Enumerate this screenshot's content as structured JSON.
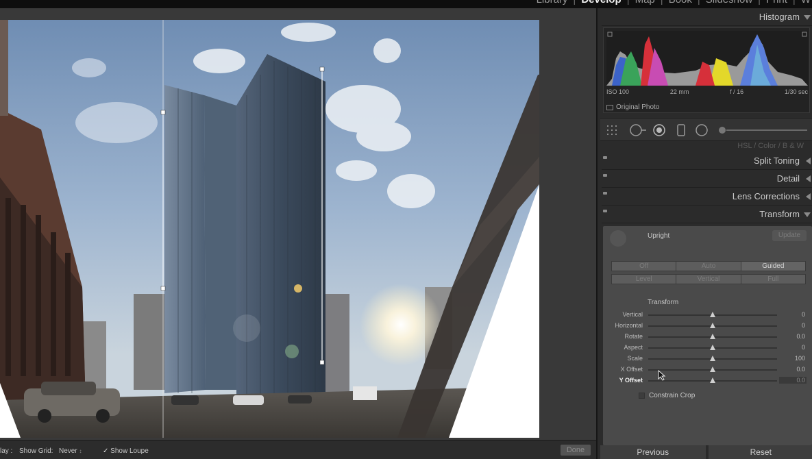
{
  "modules": [
    "Library",
    "Develop",
    "Map",
    "Book",
    "Slideshow",
    "Print",
    "W"
  ],
  "active_module": "Develop",
  "histogram": {
    "title": "Histogram",
    "iso": "ISO 100",
    "focal": "22 mm",
    "aperture": "f / 16",
    "shutter": "1/30 sec",
    "original_photo": "Original Photo"
  },
  "hsl_tabs": "HSL / Color / B & W",
  "panels": {
    "split_toning": "Split Toning",
    "detail": "Detail",
    "lens_corrections": "Lens Corrections",
    "transform": "Transform"
  },
  "transform": {
    "upright_label": "Upright",
    "update_label": "Update",
    "upright_row1": [
      "Off",
      "Auto",
      "Guided"
    ],
    "upright_row2": [
      "Level",
      "Vertical",
      "Full"
    ],
    "active_mode": "Guided",
    "section_label": "Transform",
    "sliders": [
      {
        "name": "Vertical",
        "value": "0"
      },
      {
        "name": "Horizontal",
        "value": "0"
      },
      {
        "name": "Rotate",
        "value": "0.0"
      },
      {
        "name": "Aspect",
        "value": "0"
      },
      {
        "name": "Scale",
        "value": "100"
      },
      {
        "name": "X Offset",
        "value": "0.0"
      },
      {
        "name": "Y Offset",
        "value": "0.0"
      }
    ],
    "constrain_crop": "Constrain Crop"
  },
  "buttons": {
    "previous": "Previous",
    "reset": "Reset",
    "done": "Done"
  },
  "toolbar": {
    "overlay_label": "lay :",
    "show_grid_label": "Show Grid:",
    "show_grid_value": "Never",
    "show_loupe_label": "Show Loupe",
    "show_loupe_checked": true
  },
  "colors": {
    "panel_bg": "#2b2b2b",
    "canvas_bg": "#393939",
    "transform_body_bg": "#4a4a4a"
  }
}
